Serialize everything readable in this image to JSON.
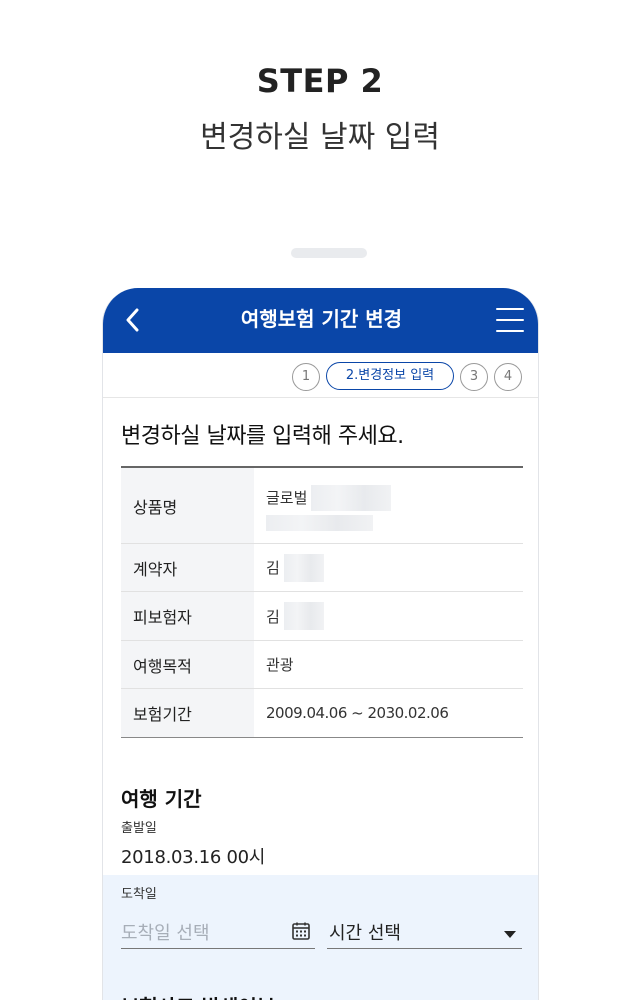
{
  "intro": {
    "step": "STEP 2",
    "subtitle": "변경하실 날짜 입력"
  },
  "header": {
    "title": "여행보험 기간 변경",
    "back_icon": "chevron-left-icon",
    "menu_icon": "hamburger-menu-icon",
    "color": "#0a46a8"
  },
  "stepper": {
    "steps": [
      "1",
      "2.변경정보 입력",
      "3",
      "4"
    ],
    "active_index": 1
  },
  "main": {
    "title": "변경하실 날짜를 입력해 주세요.",
    "info_rows": [
      {
        "label": "상품명",
        "value": "글로벌"
      },
      {
        "label": "계약자",
        "value": "김"
      },
      {
        "label": "피보험자",
        "value": "김"
      },
      {
        "label": "여행목적",
        "value": "관광"
      },
      {
        "label": "보험기간",
        "value": "2009.04.06 ~ 2030.02.06"
      }
    ]
  },
  "trip": {
    "title": "여행 기간",
    "departure_label": "출발일",
    "departure_value": "2018.03.16 00시",
    "arrival_label": "도착일",
    "arrival_placeholder": "도착일 선택",
    "time_select_value": "시간 선택",
    "next_section_title": "보험사고 발생여부"
  }
}
